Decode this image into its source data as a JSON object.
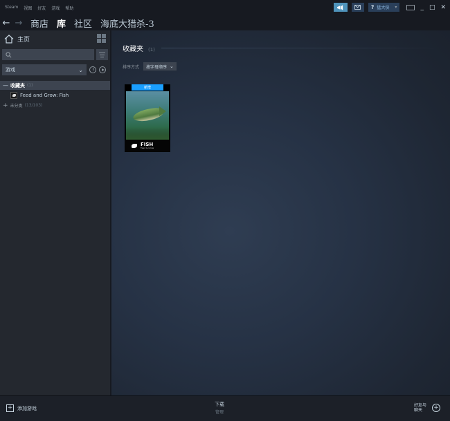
{
  "menubar": {
    "items": [
      "Steam",
      "视图",
      "好友",
      "游戏",
      "帮助"
    ],
    "user": {
      "help_glyph": "?",
      "name": "猛大侠",
      "caret": "▾"
    },
    "window_controls": [
      "_",
      "□",
      "✕"
    ]
  },
  "navbar": {
    "back": "←",
    "forward": "→",
    "links": [
      {
        "label": "商店"
      },
      {
        "label": "库"
      },
      {
        "label": "社区"
      },
      {
        "label": "海底大猎杀-3"
      }
    ]
  },
  "sidebar": {
    "home_label": "主页",
    "search_placeholder": "",
    "games_select": "游戏",
    "games_chevron": "⌄",
    "favorites": {
      "sign": "—",
      "name": "收藏夹",
      "count": "(1)"
    },
    "games": [
      {
        "name": "Feed and Grow: Fish"
      }
    ],
    "uncategorized": {
      "sign": "+",
      "name": "未分类",
      "count": "(13/103)"
    }
  },
  "main": {
    "shelf_title": "收藏夹",
    "shelf_count": "(1)",
    "sort_label": "排序方式",
    "sort_value": "按字母顺序",
    "sort_chevron": "⌄",
    "card": {
      "badge": "新增",
      "logo_big": "FISH",
      "logo_small": "Feed & Grow"
    }
  },
  "bottombar": {
    "add_game_label": "添加游戏",
    "add_glyph": "+",
    "downloads_label": "下载",
    "downloads_sub": "管理",
    "friends_label": "好友与聊天",
    "friends_glyph": "+"
  },
  "colors": {
    "accent": "#1a9fff",
    "broadcast": "#4f94bc",
    "sidebar_bg": "#24282f",
    "top_bg": "#171a21"
  }
}
